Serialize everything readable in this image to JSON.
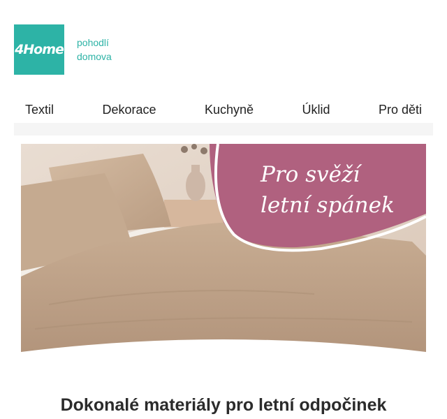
{
  "brand": {
    "logo_text": "4Home",
    "tagline_line1": "pohodlí",
    "tagline_line2": "domova"
  },
  "nav": {
    "items": [
      "Textil",
      "Dekorace",
      "Kuchyně",
      "Úklid",
      "Pro děti"
    ]
  },
  "hero": {
    "line1": "Pro svěží",
    "line2": "letní spánek",
    "accent_color": "#b0617f"
  },
  "main": {
    "headline": "Dokonalé materiály pro letní odpočinek"
  }
}
